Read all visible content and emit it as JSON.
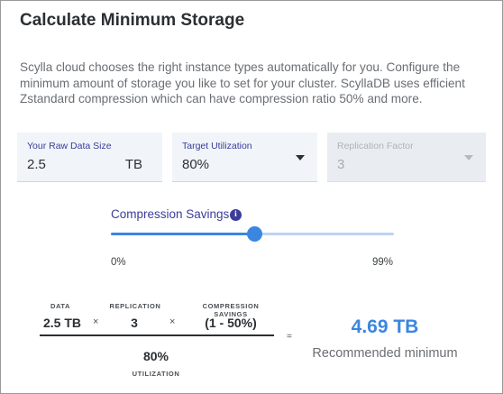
{
  "title": "Calculate Minimum Storage",
  "description": "Scylla cloud chooses the right instance types automatically for you. Configure the minimum amount of storage you like to set for your cluster. ScyllaDB uses efficient Zstandard compression which can have compression ratio 50% and more.",
  "fields": {
    "raw_data": {
      "label": "Your Raw Data Size",
      "value": "2.5",
      "unit": "TB"
    },
    "target_utilization": {
      "label": "Target Utilization",
      "value": "80%"
    },
    "replication_factor": {
      "label": "Replication Factor",
      "value": "3",
      "disabled": true
    }
  },
  "compression": {
    "label": "Compression Savings",
    "info_icon": "info-icon",
    "min_label": "0%",
    "max_label": "99%",
    "value_percent": 50,
    "max_percent": 99
  },
  "formula": {
    "data_caption": "DATA",
    "data_value": "2.5 TB",
    "replication_caption": "REPLICATION",
    "replication_value": "3",
    "compression_caption": "COMPRESSION SAVINGS",
    "compression_value": "(1 - 50%)",
    "times_symbol": "×",
    "utilization_value": "80%",
    "utilization_caption": "UTILIZATION",
    "equals_symbol": "="
  },
  "result": {
    "value": "4.69 TB",
    "caption": "Recommended minimum"
  },
  "colors": {
    "accent": "#3a86e0",
    "label": "#3a3d9a",
    "field_bg": "#f1f4f8"
  }
}
